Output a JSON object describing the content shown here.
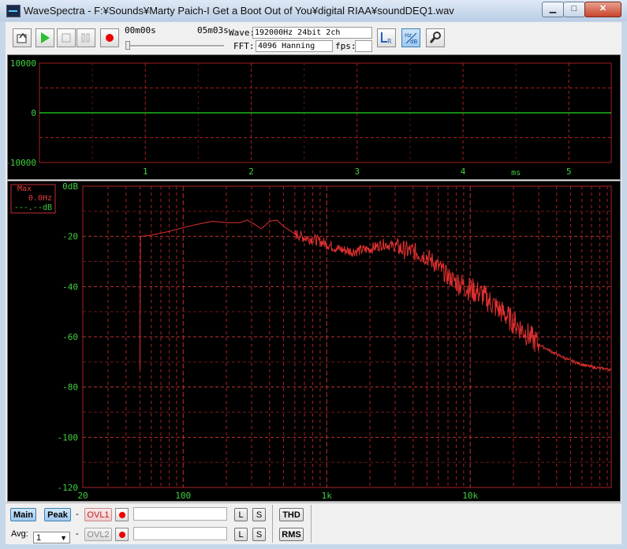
{
  "window": {
    "title": "WaveSpectra - F:¥Sounds¥Marty Paich-I Get a Boot Out of You¥digital RIAA¥soundDEQ1.wav",
    "min_label": "▁",
    "max_label": "□",
    "close_label": "✕"
  },
  "toolbar": {
    "time_start": "00m00s",
    "time_end": "05m03s",
    "wave_label": "Wave:",
    "wave_value": "192000Hz 24bit 2ch",
    "fft_label": "FFT:",
    "fft_value": "4096 Hanning",
    "fps_label": "fps:",
    "fps_value": ""
  },
  "waveform": {
    "y_ticks": [
      "10000",
      "0",
      "-10000"
    ],
    "x_ticks": [
      "1",
      "2",
      "3",
      "4",
      "5"
    ],
    "x_unit": "ms",
    "line_color": "#22dd22"
  },
  "spectrum": {
    "max_label": "Max",
    "max_freq": "0.0Hz",
    "max_db": "---.--dB",
    "y_ticks": [
      "0dB",
      "-20",
      "-40",
      "-60",
      "-80",
      "-100",
      "-120"
    ],
    "x_ticks": [
      "20",
      "100",
      "1k",
      "10k"
    ],
    "trace_color": "#e03030",
    "grid_color": "#aa2222"
  },
  "bottom": {
    "main_label": "Main",
    "peak_label": "Peak",
    "ovl1_label": "OVL1",
    "ovl2_label": "OVL2",
    "avg_label": "Avg:",
    "avg_value": "1",
    "dash": "-",
    "l_label": "L",
    "s_label": "S",
    "thd_label": "THD",
    "rms_label": "RMS"
  },
  "chart_data": {
    "type": "line",
    "xlabel": "",
    "ylabel": "",
    "x_scale": "log",
    "xlim": [
      20,
      96000
    ],
    "ylim": [
      -120,
      0
    ],
    "grid": true,
    "series": [
      {
        "x": [
          50,
          60,
          80,
          100,
          130,
          160,
          200,
          250,
          280,
          320,
          350,
          400,
          450,
          500,
          600,
          700,
          800,
          1000,
          1200,
          1500,
          2000,
          2500,
          3000,
          3500,
          4000,
          5000,
          6000,
          7000,
          8000,
          10000,
          12000,
          15000,
          20000,
          25000,
          30000,
          40000,
          50000,
          60000,
          70000,
          80000,
          96000
        ],
        "y": [
          -20,
          -19.5,
          -18,
          -16.5,
          -15,
          -14,
          -14.5,
          -14.5,
          -13.5,
          -15.5,
          -17,
          -14,
          -13.5,
          -16,
          -19,
          -20.5,
          -21,
          -23,
          -25,
          -26,
          -25,
          -23,
          -24,
          -25.5,
          -26,
          -28,
          -32,
          -36,
          -38,
          -41,
          -43,
          -48,
          -54,
          -59,
          -63,
          -67,
          -69.5,
          -71,
          -72,
          -72.5,
          -73
        ]
      }
    ]
  }
}
